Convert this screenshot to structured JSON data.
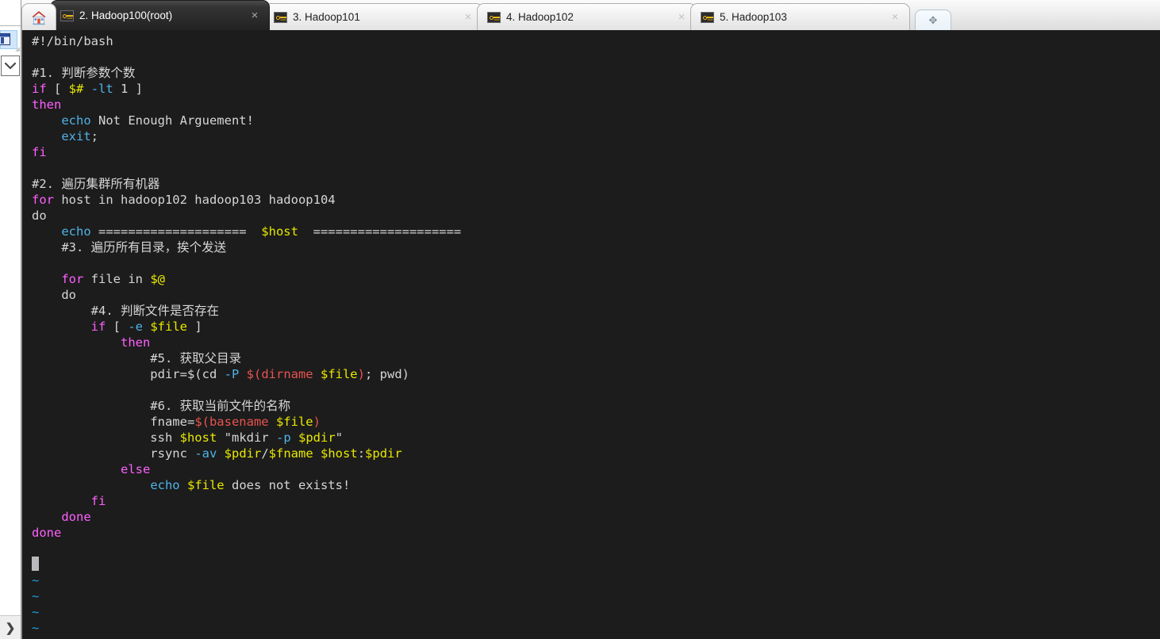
{
  "app": {
    "title": "Xshell Terminal"
  },
  "sidebar": {
    "expand_label": "❯",
    "session_node_label": "",
    "dropdown_label": "chevron-down"
  },
  "tabbar": {
    "home_tab_label": "",
    "newtab_label": "✥",
    "close_glyph": "×",
    "tabs": [
      {
        "label": "2. Hadoop100(root)",
        "active": true,
        "icon": "key-icon"
      },
      {
        "label": "3. Hadoop101",
        "active": false,
        "icon": "key-icon"
      },
      {
        "label": "4. Hadoop102",
        "active": false,
        "icon": "key-icon"
      },
      {
        "label": "5. Hadoop103",
        "active": false,
        "icon": "key-icon"
      }
    ]
  },
  "colors": {
    "terminal_bg": "#1c1c1c",
    "foreground": "#d6d6d6",
    "keyword": "#ff5fff",
    "command": "#4fb3e8",
    "variable": "#e8e800",
    "subshell": "#e8534f",
    "tilde": "#1e9fe0",
    "active_tab_bg": "#222222",
    "tabbar_bg": "#eaeaea",
    "cursor": "#b8b8bd"
  },
  "terminal": {
    "editor": "vi",
    "cursor_visible": true,
    "filler_char": "~",
    "filler_count": 4,
    "lines": [
      [
        {
          "t": "#!/bin/bash",
          "c": "fg"
        }
      ],
      [],
      [
        {
          "t": "#1. 判断参数个数",
          "c": "fg"
        }
      ],
      [
        {
          "t": "if",
          "c": "kw"
        },
        {
          "t": " [ ",
          "c": "fg"
        },
        {
          "t": "$#",
          "c": "var"
        },
        {
          "t": " ",
          "c": "fg"
        },
        {
          "t": "-lt",
          "c": "opt"
        },
        {
          "t": " 1 ]",
          "c": "fg"
        }
      ],
      [
        {
          "t": "then",
          "c": "kw"
        }
      ],
      [
        {
          "t": "    ",
          "c": "fg"
        },
        {
          "t": "echo",
          "c": "cmd"
        },
        {
          "t": " Not Enough Arguement!",
          "c": "fg"
        }
      ],
      [
        {
          "t": "    ",
          "c": "fg"
        },
        {
          "t": "exit",
          "c": "cmd"
        },
        {
          "t": ";",
          "c": "fg"
        }
      ],
      [
        {
          "t": "fi",
          "c": "kw"
        }
      ],
      [],
      [
        {
          "t": "#2. 遍历集群所有机器",
          "c": "fg"
        }
      ],
      [
        {
          "t": "for",
          "c": "kw"
        },
        {
          "t": " host in hadoop102 hadoop103 hadoop104",
          "c": "fg"
        }
      ],
      [
        {
          "t": "do",
          "c": "fg"
        }
      ],
      [
        {
          "t": "    ",
          "c": "fg"
        },
        {
          "t": "echo",
          "c": "cmd"
        },
        {
          "t": " ====================  ",
          "c": "fg"
        },
        {
          "t": "$host",
          "c": "var"
        },
        {
          "t": "  ====================",
          "c": "fg"
        }
      ],
      [
        {
          "t": "    #3. 遍历所有目录，挨个发送",
          "c": "fg"
        }
      ],
      [],
      [
        {
          "t": "    ",
          "c": "fg"
        },
        {
          "t": "for",
          "c": "kw"
        },
        {
          "t": " file in ",
          "c": "fg"
        },
        {
          "t": "$@",
          "c": "var"
        }
      ],
      [
        {
          "t": "    do",
          "c": "fg"
        }
      ],
      [
        {
          "t": "        #4. 判断文件是否存在",
          "c": "fg"
        }
      ],
      [
        {
          "t": "        ",
          "c": "fg"
        },
        {
          "t": "if",
          "c": "kw"
        },
        {
          "t": " [ ",
          "c": "fg"
        },
        {
          "t": "-e",
          "c": "opt"
        },
        {
          "t": " ",
          "c": "fg"
        },
        {
          "t": "$file",
          "c": "var"
        },
        {
          "t": " ]",
          "c": "fg"
        }
      ],
      [
        {
          "t": "            ",
          "c": "fg"
        },
        {
          "t": "then",
          "c": "kw"
        }
      ],
      [
        {
          "t": "                #5. 获取父目录",
          "c": "fg"
        }
      ],
      [
        {
          "t": "                pdir=",
          "c": "fg"
        },
        {
          "t": "$(",
          "c": "fg"
        },
        {
          "t": "cd ",
          "c": "fg"
        },
        {
          "t": "-P",
          "c": "opt"
        },
        {
          "t": " ",
          "c": "fg"
        },
        {
          "t": "$(dirname ",
          "c": "red"
        },
        {
          "t": "$file",
          "c": "var"
        },
        {
          "t": ")",
          "c": "red"
        },
        {
          "t": "; pwd)",
          "c": "fg"
        }
      ],
      [],
      [
        {
          "t": "                #6. 获取当前文件的名称",
          "c": "fg"
        }
      ],
      [
        {
          "t": "                fname=",
          "c": "fg"
        },
        {
          "t": "$(basename ",
          "c": "red"
        },
        {
          "t": "$file",
          "c": "var"
        },
        {
          "t": ")",
          "c": "red"
        }
      ],
      [
        {
          "t": "                ssh ",
          "c": "fg"
        },
        {
          "t": "$host",
          "c": "var"
        },
        {
          "t": " ",
          "c": "fg"
        },
        {
          "t": "\"mkdir ",
          "c": "fg"
        },
        {
          "t": "-p",
          "c": "opt"
        },
        {
          "t": " ",
          "c": "fg"
        },
        {
          "t": "$pdir",
          "c": "var"
        },
        {
          "t": "\"",
          "c": "fg"
        }
      ],
      [
        {
          "t": "                rsync ",
          "c": "fg"
        },
        {
          "t": "-av",
          "c": "opt"
        },
        {
          "t": " ",
          "c": "fg"
        },
        {
          "t": "$pdir",
          "c": "var"
        },
        {
          "t": "/",
          "c": "fg"
        },
        {
          "t": "$fname",
          "c": "var"
        },
        {
          "t": " ",
          "c": "fg"
        },
        {
          "t": "$host",
          "c": "var"
        },
        {
          "t": ":",
          "c": "fg"
        },
        {
          "t": "$pdir",
          "c": "var"
        }
      ],
      [
        {
          "t": "            ",
          "c": "fg"
        },
        {
          "t": "else",
          "c": "kw"
        }
      ],
      [
        {
          "t": "                ",
          "c": "fg"
        },
        {
          "t": "echo",
          "c": "cmd"
        },
        {
          "t": " ",
          "c": "fg"
        },
        {
          "t": "$file",
          "c": "var"
        },
        {
          "t": " does not exists!",
          "c": "fg"
        }
      ],
      [
        {
          "t": "        ",
          "c": "fg"
        },
        {
          "t": "fi",
          "c": "kw"
        }
      ],
      [
        {
          "t": "    ",
          "c": "fg"
        },
        {
          "t": "done",
          "c": "kw"
        }
      ],
      [
        {
          "t": "done",
          "c": "kw"
        }
      ],
      []
    ]
  }
}
